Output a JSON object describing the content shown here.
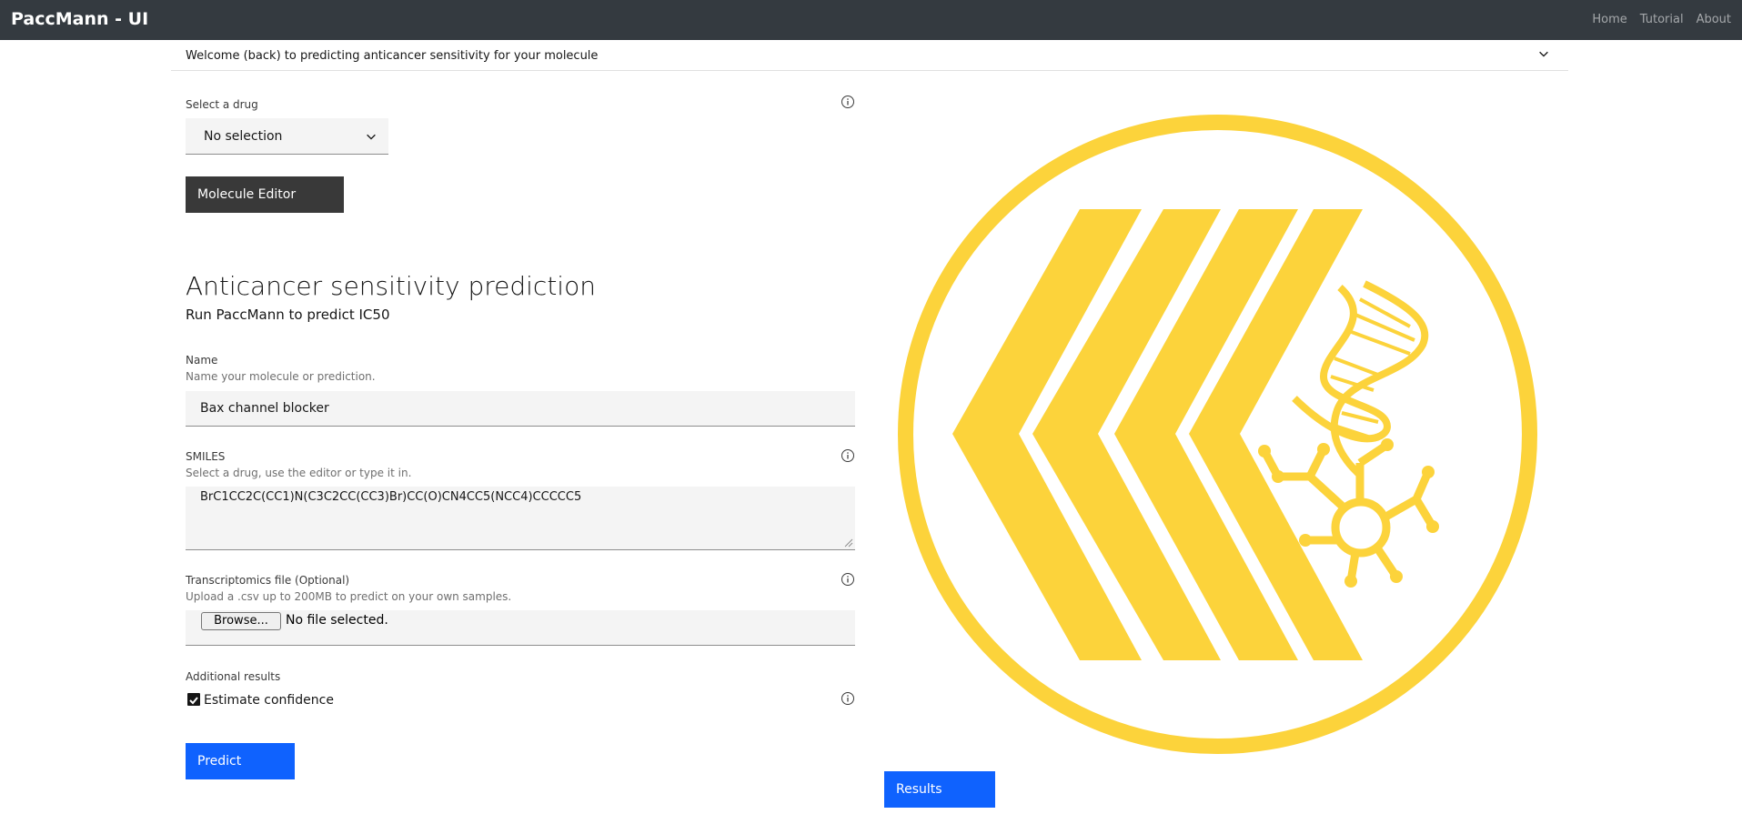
{
  "app": {
    "title": "PaccMann - UI"
  },
  "nav": {
    "links": [
      "Home",
      "Tutorial",
      "About"
    ]
  },
  "accordion": {
    "title": "Welcome (back) to predicting anticancer sensitivity for your molecule"
  },
  "drug_select": {
    "label": "Select a drug",
    "value": "No selection"
  },
  "molecule_editor_button": "Molecule Editor",
  "section": {
    "title": "Anticancer sensitivity prediction",
    "subtitle": "Run PaccMann to predict IC50"
  },
  "name_field": {
    "label": "Name",
    "helper": "Name your molecule or prediction.",
    "value": "Bax channel blocker"
  },
  "smiles_field": {
    "label": "SMILES",
    "helper": "Select a drug, use the editor or type it in.",
    "value": "BrC1CC2C(CC1)N(C3C2CC(CC3)Br)CC(O)CN4CC5(NCC4)CCCCC5"
  },
  "transcriptomics_field": {
    "label": "Transcriptomics file (Optional)",
    "helper": "Upload a .csv up to 200MB to predict on your own samples.",
    "browse_label": "Browse...",
    "status": "No file selected."
  },
  "additional_results": {
    "label": "Additional results",
    "checkbox_label": "Estimate confidence",
    "checked": true
  },
  "predict_button": "Predict",
  "results_button": "Results",
  "colors": {
    "navbar": "#343a40",
    "primary": "#0f62fe",
    "dark_button": "#393939",
    "logo": "#fcd33b"
  },
  "icons": {
    "info": "info-icon",
    "chevron": "chevron-down-icon",
    "checkmark": "checkmark-icon",
    "logo": "paccmann-logo"
  }
}
